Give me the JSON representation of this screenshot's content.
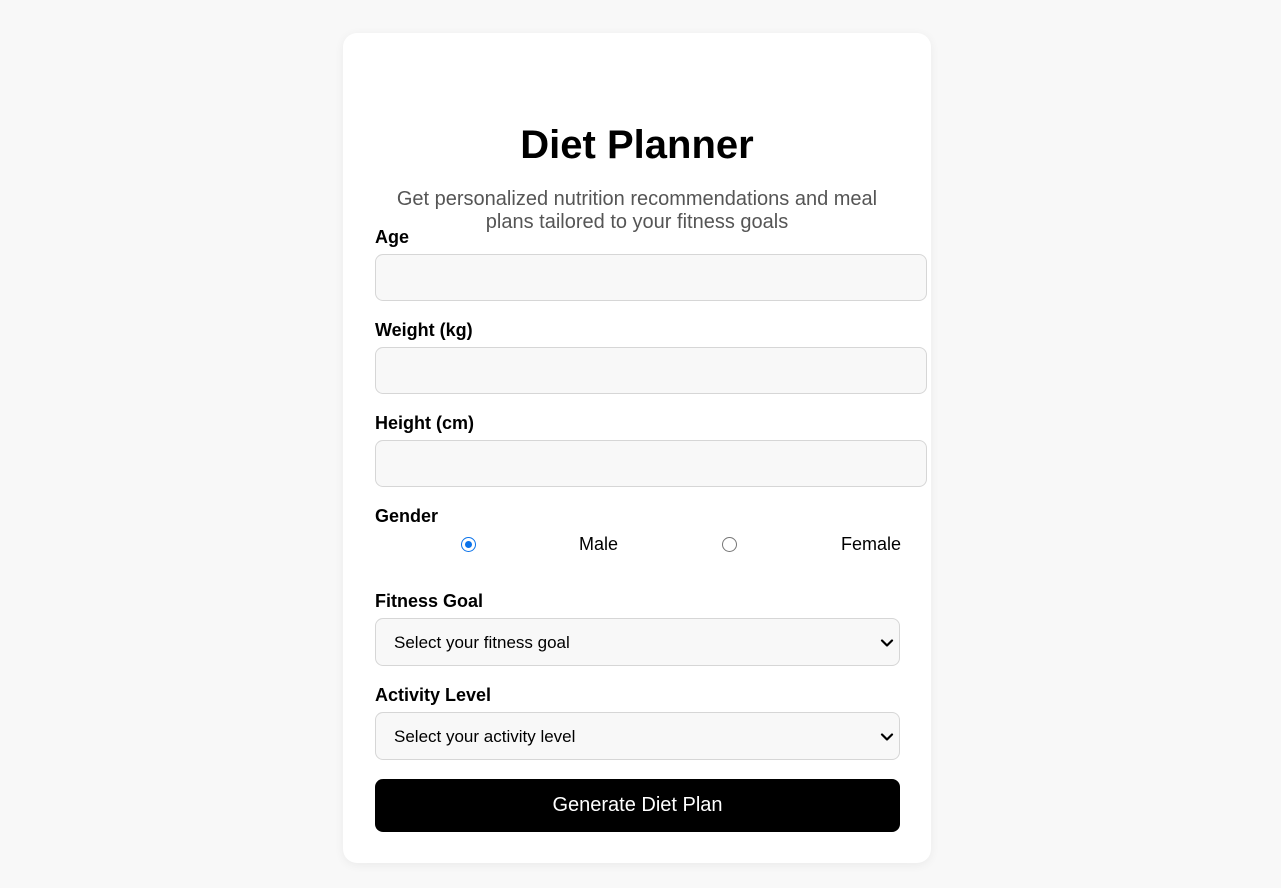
{
  "header": {
    "title": "Diet Planner",
    "subtitle": "Get personalized nutrition recommendations and meal plans tailored to your fitness goals"
  },
  "form": {
    "age": {
      "label": "Age",
      "value": "",
      "placeholder": ""
    },
    "weight": {
      "label": "Weight (kg)",
      "value": "",
      "placeholder": ""
    },
    "height": {
      "label": "Height (cm)",
      "value": "",
      "placeholder": ""
    },
    "gender": {
      "label": "Gender",
      "options": [
        {
          "label": "Male",
          "checked": true
        },
        {
          "label": "Female",
          "checked": false
        }
      ]
    },
    "fitness_goal": {
      "label": "Fitness Goal",
      "selected": "Select your fitness goal"
    },
    "activity_level": {
      "label": "Activity Level",
      "selected": "Select your activity level"
    },
    "submit_label": "Generate Diet Plan"
  },
  "colors": {
    "page_background": "#f8f8f8",
    "card_background": "#ffffff",
    "button_background": "#000000",
    "radio_accent": "#0b73ea",
    "subtitle_text": "#555555"
  },
  "icons": {
    "select_arrow": "chevron-down-icon"
  }
}
